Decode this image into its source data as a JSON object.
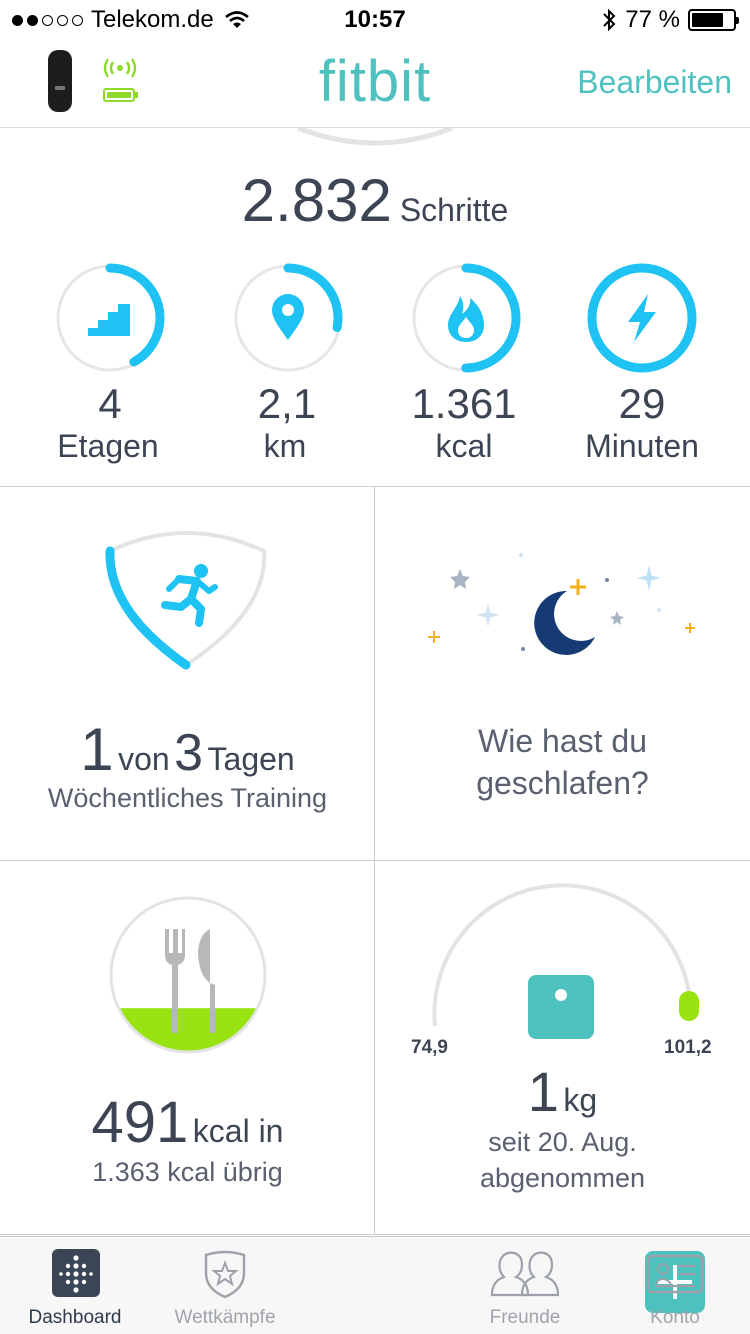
{
  "status": {
    "carrier": "Telekom.de",
    "time": "10:57",
    "battery": "77 %"
  },
  "header": {
    "brand": "fitbit",
    "edit_label": "Bearbeiten"
  },
  "steps": {
    "value": "2.832",
    "unit": "Schritte"
  },
  "stats": [
    {
      "value": "4",
      "unit": "Etagen",
      "icon": "stairs-icon",
      "progress": 0.42
    },
    {
      "value": "2,1",
      "unit": "km",
      "icon": "location-pin-icon",
      "progress": 0.28
    },
    {
      "value": "1.361",
      "unit": "kcal",
      "icon": "flame-icon",
      "progress": 0.5
    },
    {
      "value": "29",
      "unit": "Minuten",
      "icon": "lightning-icon",
      "progress": 1.0
    }
  ],
  "tiles": {
    "exercise": {
      "count": "1",
      "von": "von",
      "total": "3",
      "unit": "Tagen",
      "subtitle": "Wöchentliches Training"
    },
    "sleep": {
      "line1": "Wie hast du",
      "line2": "geschlafen?"
    },
    "food": {
      "value": "491",
      "unit": "kcal in",
      "remaining": "1.363 kcal übrig"
    },
    "weight": {
      "min": "74,9",
      "max": "101,2",
      "value": "1",
      "unit": "kg",
      "since": "seit 20. Aug.",
      "label": "abgenommen"
    }
  },
  "tabs": [
    {
      "label": "Dashboard",
      "active": true
    },
    {
      "label": "Wettkämpfe"
    },
    {
      "label": ""
    },
    {
      "label": "Freunde"
    },
    {
      "label": "Konto"
    }
  ],
  "colors": {
    "accent": "#4fc1bf",
    "ring": "#1ec3f3",
    "lime": "#99e311",
    "navy": "#163b74"
  }
}
